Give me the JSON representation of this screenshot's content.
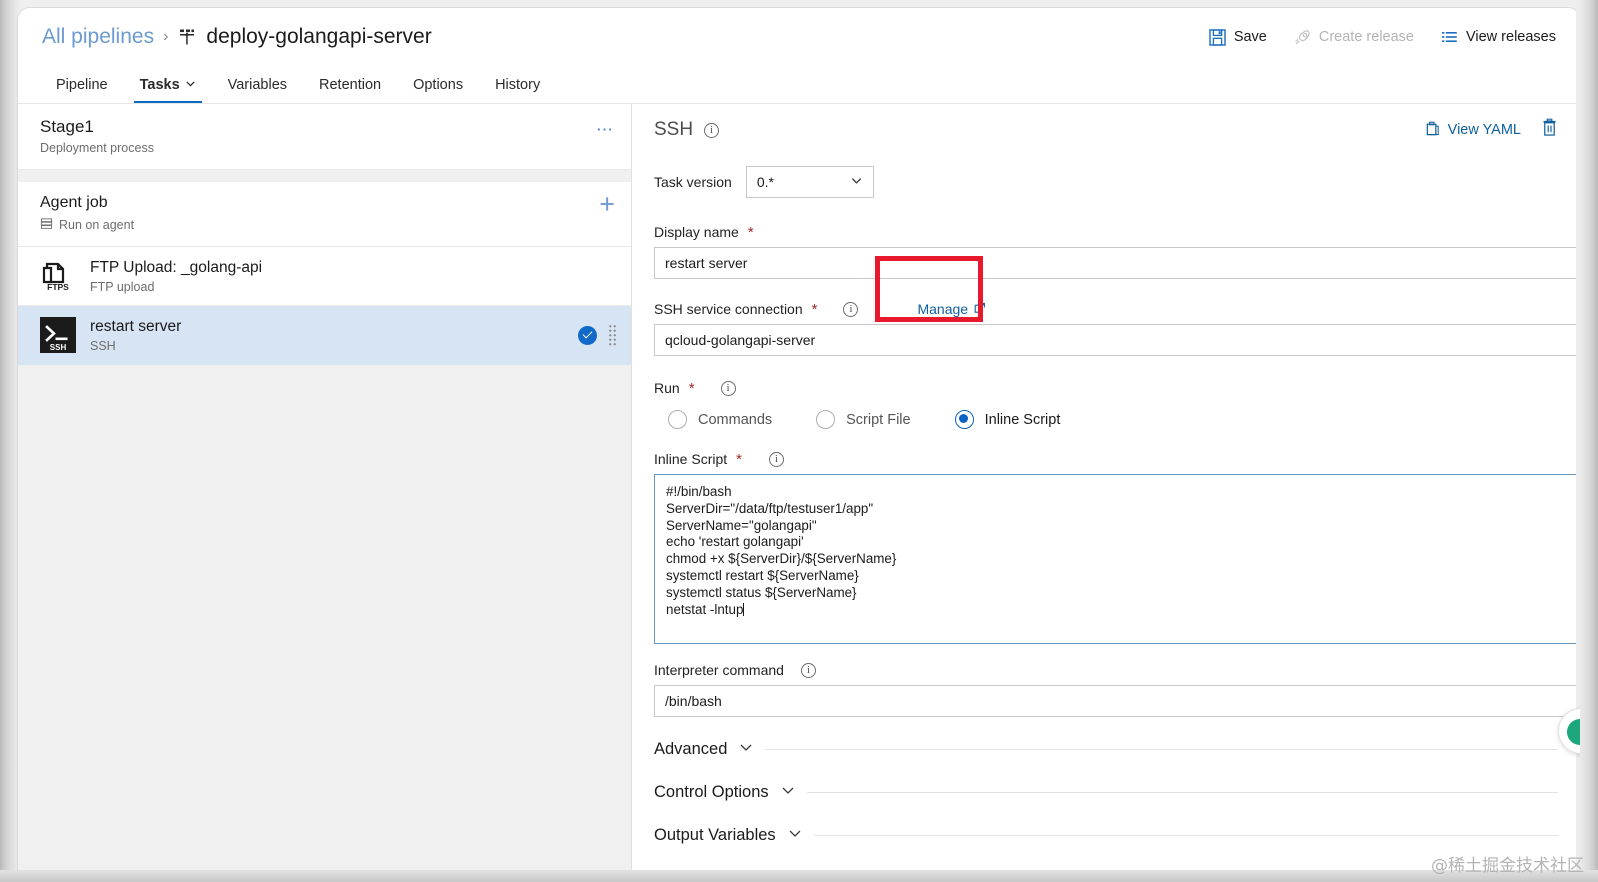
{
  "breadcrumb": {
    "root_label": "All pipelines",
    "separator": "›",
    "pipeline_icon": "pipeline-icon",
    "title": "deploy-golangapi-server"
  },
  "header_actions": [
    {
      "label": "Save",
      "icon": "save-icon",
      "disabled": false
    },
    {
      "label": "Create release",
      "icon": "rocket-icon",
      "disabled": true
    },
    {
      "label": "View releases",
      "icon": "list-icon",
      "disabled": false
    }
  ],
  "tabs": [
    {
      "label": "Pipeline",
      "active": false,
      "has_chevron": false
    },
    {
      "label": "Tasks",
      "active": true,
      "has_chevron": true
    },
    {
      "label": "Variables",
      "active": false,
      "has_chevron": false
    },
    {
      "label": "Retention",
      "active": false,
      "has_chevron": false
    },
    {
      "label": "Options",
      "active": false,
      "has_chevron": false
    },
    {
      "label": "History",
      "active": false,
      "has_chevron": false
    }
  ],
  "sidebar": {
    "stage": {
      "title": "Stage1",
      "subtitle": "Deployment process",
      "menu_icon": "ellipsis-icon"
    },
    "job": {
      "title": "Agent job",
      "subtitle": "Run on agent",
      "subtitle_icon": "agent-icon",
      "add_icon": "plus-icon"
    },
    "tasks": [
      {
        "name": "FTP Upload: _golang-api",
        "subtitle": "FTP upload",
        "icon": "ftps-icon",
        "selected": false
      },
      {
        "name": "restart server",
        "subtitle": "SSH",
        "icon": "ssh-icon",
        "selected": true,
        "status_icon": "enabled-check-icon",
        "drag_icon": "drag-handle-icon"
      }
    ]
  },
  "task_panel": {
    "title": "SSH",
    "title_info_icon": "info-icon",
    "view_yaml_label": "View YAML",
    "view_yaml_icon": "yaml-clipboard-icon",
    "delete_icon": "trash-icon",
    "task_version": {
      "label": "Task version",
      "value": "0.*",
      "chevron_icon": "chevron-down-icon"
    },
    "display_name": {
      "label": "Display name",
      "required": true,
      "value": "restart server"
    },
    "ssh_service_connection": {
      "label": "SSH service connection",
      "required": true,
      "info_icon": "info-icon",
      "manage_label": "Manage",
      "manage_icon": "external-link-icon",
      "value": "qcloud-golangapi-server",
      "chevron_icon": "chevron-down-icon"
    },
    "run": {
      "label": "Run",
      "required": true,
      "info_icon": "info-icon",
      "options": [
        {
          "label": "Commands",
          "checked": false
        },
        {
          "label": "Script File",
          "checked": false
        },
        {
          "label": "Inline Script",
          "checked": true
        }
      ]
    },
    "inline_script": {
      "label": "Inline Script",
      "required": true,
      "info_icon": "info-icon",
      "value": "#!/bin/bash\nServerDir=\"/data/ftp/testuser1/app\"\nServerName=\"golangapi\"\necho 'restart golangapi'\nchmod +x ${ServerDir}/${ServerName}\nsystemctl restart ${ServerName}\nsystemctl status ${ServerName}\nnetstat -lntup"
    },
    "interpreter_command": {
      "label": "Interpreter command",
      "required": false,
      "info_icon": "info-icon",
      "value": "/bin/bash"
    },
    "collapsible_sections": [
      {
        "label": "Advanced",
        "icon": "chevron-down-icon",
        "expanded": false
      },
      {
        "label": "Control Options",
        "icon": "chevron-down-icon",
        "expanded": false
      },
      {
        "label": "Output Variables",
        "icon": "chevron-down-icon",
        "expanded": false
      }
    ]
  },
  "annotation": {
    "color": "#e8192c",
    "target": "Manage"
  },
  "floating_widget": {
    "icon": "green-chat-bubble-icon",
    "color": "#1ea67c"
  },
  "watermark": {
    "text": "@稀土掘金技术社区"
  },
  "theme": {
    "accent_blue": "#0b6ac4",
    "link_blue": "#10609e",
    "selected_row": "#d6e4f4",
    "required_red": "#a4262c",
    "annotation_red": "#e8192c"
  }
}
